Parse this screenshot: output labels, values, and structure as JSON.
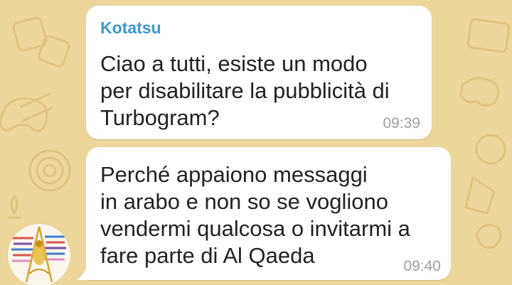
{
  "colors": {
    "wallpaper": "#ecd79a",
    "bubble": "#ffffff",
    "sender_name": "#3b97d6",
    "message_text": "#222222",
    "timestamp": "#9e9e9e"
  },
  "chat": {
    "messages": [
      {
        "sender": "Kotatsu",
        "text": "Ciao a tutti, esiste un modo\nper disabilitare la pubblicità di\nTurbogram?",
        "time": "09:39"
      },
      {
        "text": "Perché appaiono messaggi\nin arabo e non so se vogliono\nvendermi qualcosa o invitarmi a\nfare parte di Al Qaeda",
        "time": "09:40"
      }
    ],
    "avatar_icon": "sender-avatar-icon"
  }
}
